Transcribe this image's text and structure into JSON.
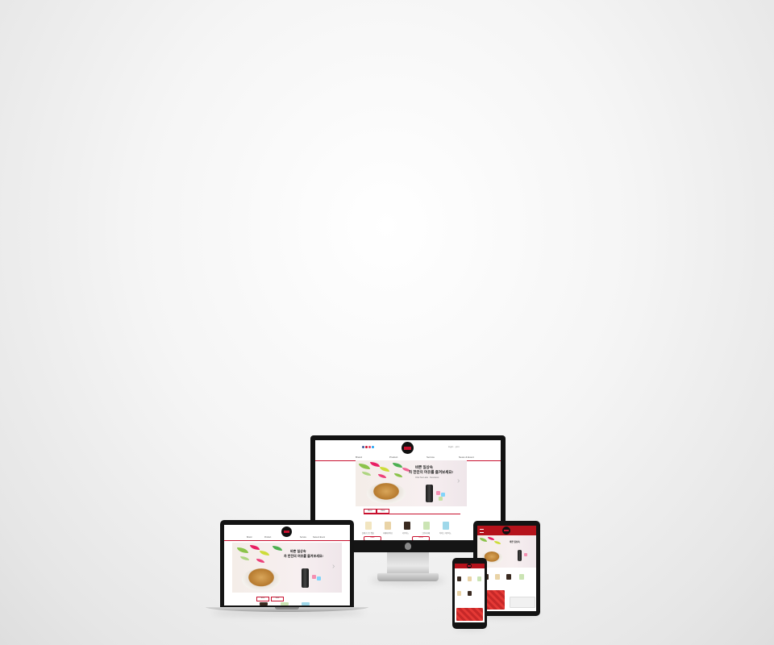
{
  "colors": {
    "brand_red": "#c8102e",
    "background": "#efefef"
  },
  "site": {
    "nav": [
      "Brand",
      "Product",
      "Service",
      "News & Event"
    ],
    "top_links": "login · join",
    "banner": {
      "headline_1": "바쁜 일상속",
      "headline_2": "차 한잔의 여유를 즐겨보세요!",
      "sub": "Chai Tea Latte · Nescasso"
    },
    "tabs": [
      "Best",
      "New"
    ],
    "products": [
      "돌체구스토 캡슐",
      "라떼마끼아또",
      "카푸치노",
      "그린티라떼",
      "아이스 카푸치노"
    ],
    "buttons": [
      "more",
      "event"
    ]
  },
  "devices": [
    "monitor",
    "laptop",
    "tablet",
    "phone"
  ]
}
